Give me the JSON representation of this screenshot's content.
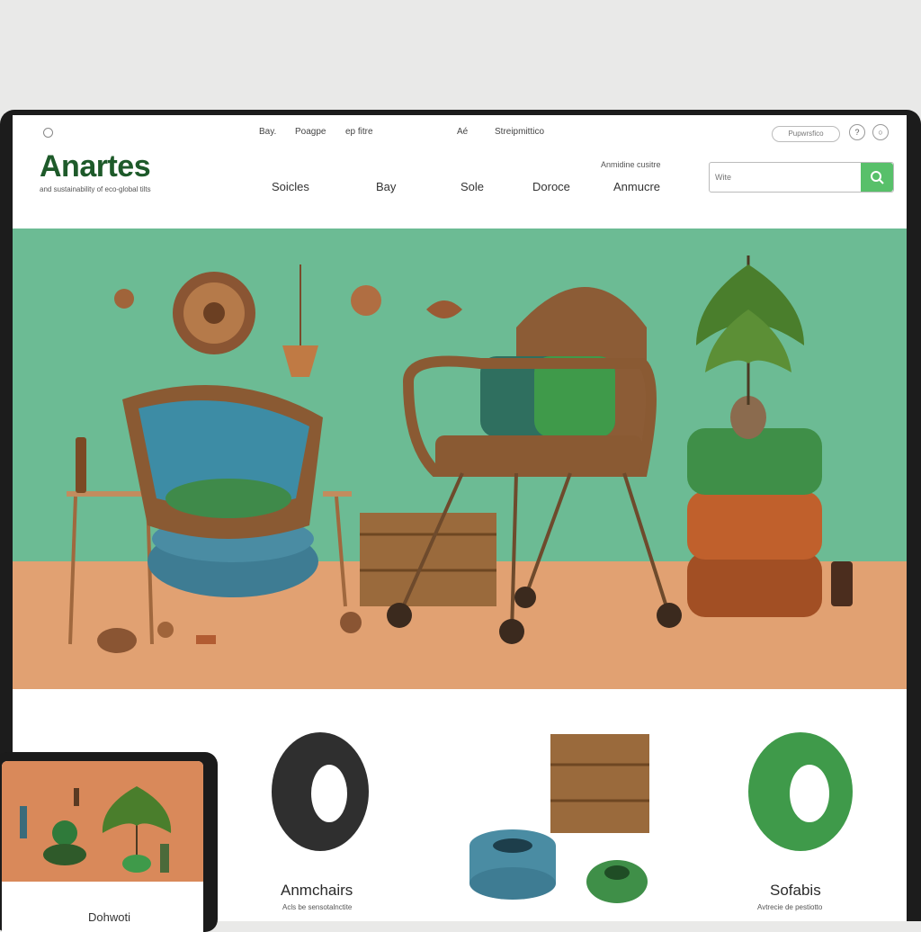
{
  "utility_nav": [
    "Bay.",
    "Poagpe",
    "ep fitre",
    "Aé",
    "Streipmittico"
  ],
  "utility_pill": "Pupwrsfico",
  "utility_icons": [
    "help-icon",
    "globe-icon"
  ],
  "brand": {
    "name": "Anartes",
    "tagline": "and sustainability of eco-global tilts"
  },
  "nav": {
    "note": "Anmidine cusitre",
    "items": [
      "Soicles",
      "Bay",
      "Sole",
      "Doroce",
      "Anmucre"
    ]
  },
  "search": {
    "placeholder": "Wite"
  },
  "products": [
    {
      "label": "",
      "sub": ""
    },
    {
      "label": "Anmchairs",
      "sub": "Acls be sensotalnctite"
    },
    {
      "label": "",
      "sub": ""
    },
    {
      "label": "Sofabis",
      "sub": "Avtrecie de pestiotto"
    }
  ],
  "tablet": {
    "label": "Dohwoti"
  },
  "colors": {
    "brand_green": "#1e5a2a",
    "hero_wall": "#6cbb94",
    "hero_floor": "#e1a172",
    "search_button": "#58c06a"
  }
}
